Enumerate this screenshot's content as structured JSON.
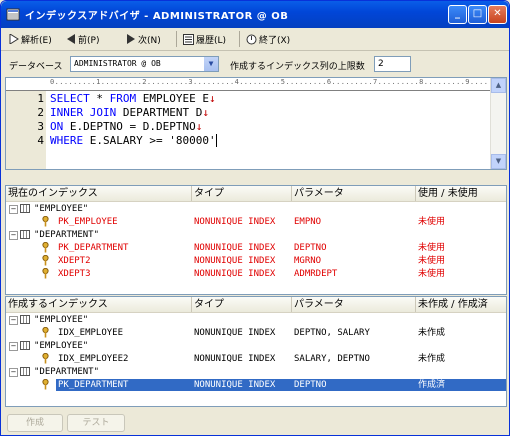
{
  "window": {
    "title": "インデックスアドバイザ - ADMINISTRATOR @ OB",
    "min_label": "_",
    "max_label": "□",
    "close_label": "✕"
  },
  "toolbar": {
    "analyze": "解析(E)",
    "prev": "前(P)",
    "next": "次(N)",
    "history": "履歴(L)",
    "exit": "終了(X)"
  },
  "db": {
    "label": "データベース",
    "value": "ADMINISTRATOR @ OB",
    "limit_label": "作成するインデックス列の上限数",
    "limit_value": "2"
  },
  "editor": {
    "ruler_text": "0.........1.........2.........3.........4.........5.........6.........7.........8.........9.........10",
    "lines": [
      {
        "num": "1",
        "kw1": "SELECT",
        "mid1": " * ",
        "kw2": "FROM",
        "rest": " EMPLOYEE E",
        "nl": "↓"
      },
      {
        "num": "2",
        "kw1": "INNER JOIN",
        "mid1": " DEPARTMENT D",
        "kw2": "",
        "rest": "",
        "nl": "↓"
      },
      {
        "num": "3",
        "kw1": "ON",
        "mid1": " E.DEPTNO = D.DEPTNO",
        "kw2": "",
        "rest": "",
        "nl": "↓"
      },
      {
        "num": "4",
        "kw1": "WHERE",
        "mid1": " E.SALARY >= '80000'",
        "kw2": "",
        "rest": "",
        "nl": ""
      }
    ]
  },
  "current": {
    "headers": [
      "現在のインデックス",
      "タイプ",
      "パラメータ",
      "使用 / 未使用"
    ],
    "groups": [
      {
        "name": "\"EMPLOYEE\"",
        "rows": [
          {
            "name": "PK_EMPLOYEE",
            "type": "NONUNIQUE INDEX",
            "param": "EMPNO",
            "status": "未使用"
          }
        ]
      },
      {
        "name": "\"DEPARTMENT\"",
        "rows": [
          {
            "name": "PK_DEPARTMENT",
            "type": "NONUNIQUE INDEX",
            "param": "DEPTNO",
            "status": "未使用"
          },
          {
            "name": "XDEPT2",
            "type": "NONUNIQUE INDEX",
            "param": "MGRNO",
            "status": "未使用"
          },
          {
            "name": "XDEPT3",
            "type": "NONUNIQUE INDEX",
            "param": "ADMRDEPT",
            "status": "未使用"
          }
        ]
      }
    ]
  },
  "create": {
    "headers": [
      "作成するインデックス",
      "タイプ",
      "パラメータ",
      "未作成 / 作成済"
    ],
    "groups": [
      {
        "name": "\"EMPLOYEE\"",
        "rows": [
          {
            "name": "IDX_EMPLOYEE",
            "type": "NONUNIQUE INDEX",
            "param": "DEPTNO, SALARY",
            "status": "未作成"
          }
        ]
      },
      {
        "name": "\"EMPLOYEE\"",
        "rows": [
          {
            "name": "IDX_EMPLOYEE2",
            "type": "NONUNIQUE INDEX",
            "param": "SALARY, DEPTNO",
            "status": "未作成"
          }
        ]
      },
      {
        "name": "\"DEPARTMENT\"",
        "rows": [
          {
            "name": "PK_DEPARTMENT",
            "type": "NONUNIQUE INDEX",
            "param": "DEPTNO",
            "status": "作成済"
          }
        ]
      }
    ]
  },
  "buttons": {
    "create": "作成",
    "test": "テスト"
  },
  "colors": {
    "keyword": "#0000ff",
    "unused": "#e00000",
    "selection": "#316ac5"
  }
}
